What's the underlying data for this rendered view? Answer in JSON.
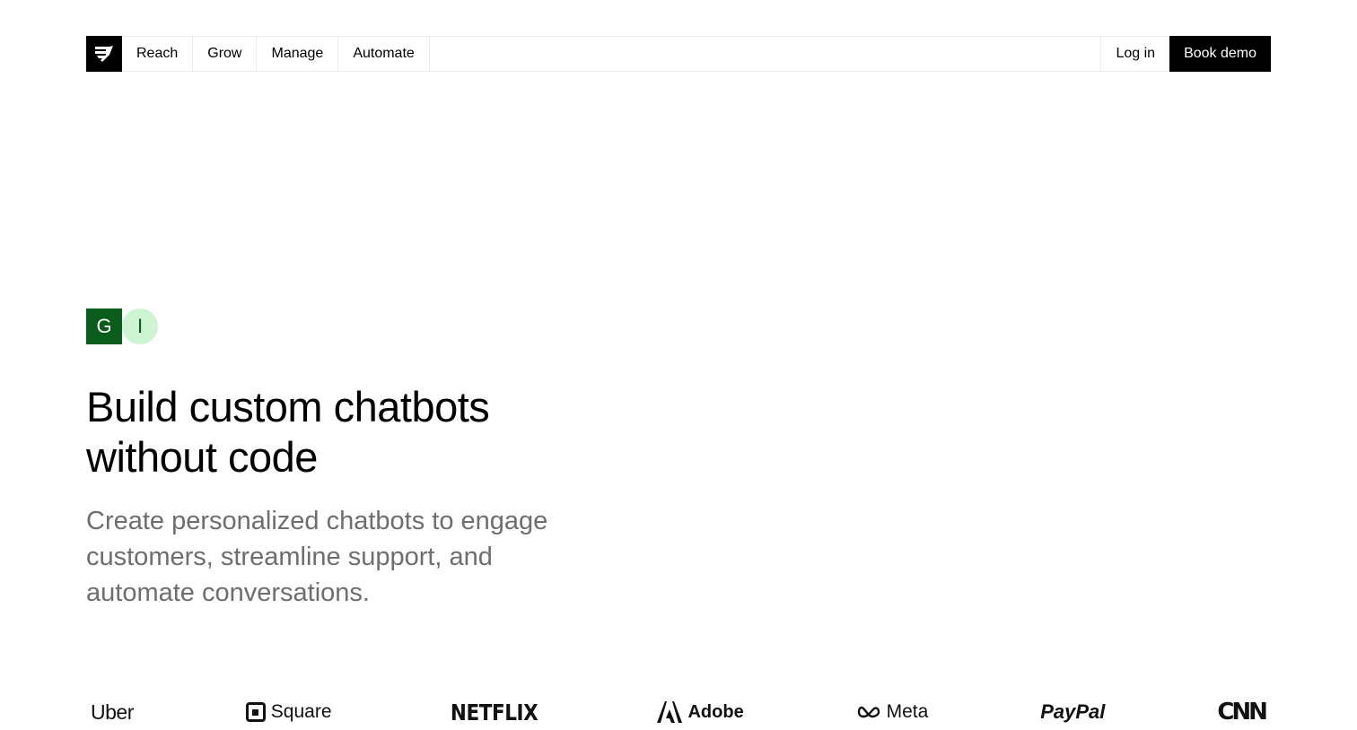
{
  "nav": {
    "logo_icon": "brand-logo-icon",
    "items": [
      {
        "label": "Reach"
      },
      {
        "label": "Grow"
      },
      {
        "label": "Manage"
      },
      {
        "label": "Automate"
      }
    ],
    "login_label": "Log in",
    "book_demo_label": "Book demo"
  },
  "hero": {
    "badges": [
      "G",
      "I"
    ],
    "headline_line1": "Build custom chatbots",
    "headline_line2": "without code",
    "subhead": "Create personalized chatbots to engage customers, streamline support, and automate conversations."
  },
  "logos": [
    {
      "name": "Uber"
    },
    {
      "name": "Square"
    },
    {
      "name": "NETFLIX"
    },
    {
      "name": "Adobe"
    },
    {
      "name": "Meta"
    },
    {
      "name": "PayPal"
    },
    {
      "name": "CNN"
    }
  ],
  "colors": {
    "accent": "#000000",
    "badge_green_dark": "#0a5c1a",
    "badge_green_light": "#cdf5d1",
    "subtext": "#6e6e6e"
  }
}
